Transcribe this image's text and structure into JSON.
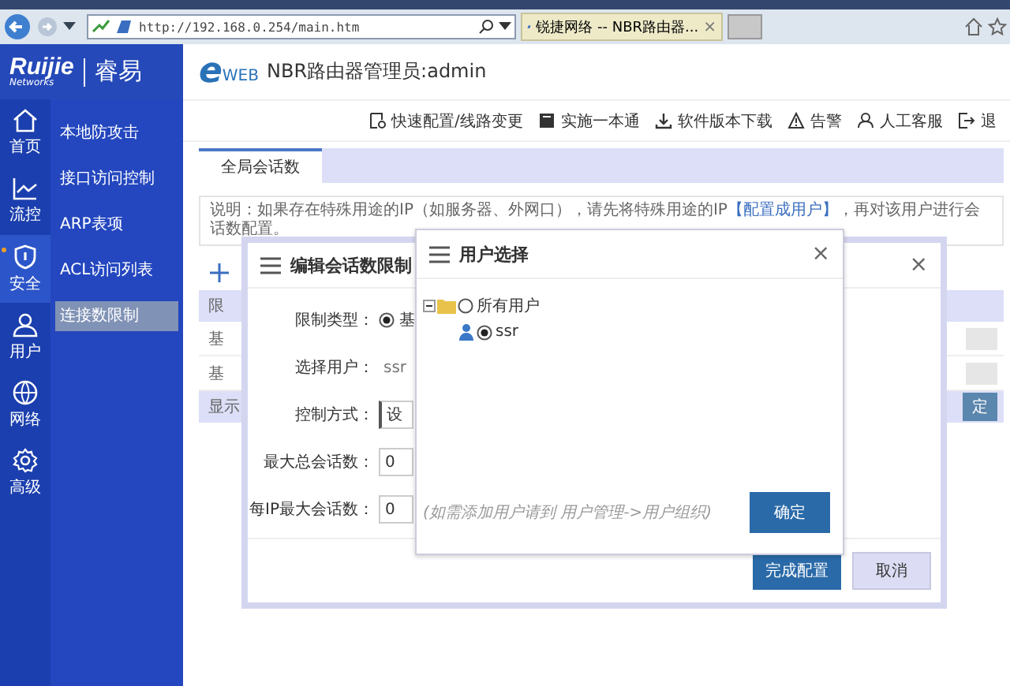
{
  "browser": {
    "address": "http://192.168.0.254/main.htm",
    "tab": {
      "title": "锐捷网络 -- NBR路由器...",
      "close": "×"
    }
  },
  "header": {
    "logo": "Ruijie",
    "logo_sub": "Networks",
    "brand": "睿易",
    "eweb_mark": "e",
    "eweb": "WEB",
    "title": "NBR路由器管理员:admin"
  },
  "toolbar": [
    {
      "kind": "config",
      "label": "快速配置/线路变更"
    },
    {
      "kind": "book",
      "label": "实施一本通"
    },
    {
      "kind": "download",
      "label": "软件版本下载"
    },
    {
      "kind": "warning",
      "label": "告警"
    },
    {
      "kind": "user",
      "label": "人工客服"
    },
    {
      "kind": "exit",
      "label": "退"
    }
  ],
  "nav": [
    {
      "kind": "home",
      "label": "首页",
      "selected": false
    },
    {
      "kind": "chart",
      "label": "流控",
      "selected": false
    },
    {
      "kind": "shield",
      "label": "安全",
      "selected": true
    },
    {
      "kind": "user",
      "label": "用户",
      "selected": false
    },
    {
      "kind": "globe",
      "label": "网络",
      "selected": false
    },
    {
      "kind": "gear",
      "label": "高级",
      "selected": false
    }
  ],
  "submenu": [
    {
      "label": "本地防攻击",
      "selected": false
    },
    {
      "label": "接口访问控制",
      "selected": false
    },
    {
      "label": "ARP表项",
      "selected": false
    },
    {
      "label": "ACL访问列表",
      "selected": false
    },
    {
      "label": "连接数限制",
      "selected": true
    }
  ],
  "tabs": [
    {
      "label": "全局会话数",
      "selected": true
    }
  ],
  "notice": {
    "before": "说明：如果存在特殊用途的IP（如服务器、外网口），请先将特殊用途的IP",
    "link": "【配置成用户】",
    "after": "，再对该用户进行会话数配置。"
  },
  "table": {
    "header": "限",
    "rows": [
      "基",
      "基"
    ],
    "footer": "显示",
    "footer_button": "定"
  },
  "dialog": {
    "title": "编辑会话数限制",
    "close": "×",
    "fields": [
      {
        "kind": "radio",
        "label": "限制类型：",
        "value": "基",
        "checked": true
      },
      {
        "kind": "text",
        "label": "选择用户：",
        "value": "ssr"
      },
      {
        "kind": "select",
        "label": "控制方式：",
        "value": "设"
      },
      {
        "kind": "input",
        "label": "最大总会话数：",
        "value": "0"
      },
      {
        "kind": "input",
        "label": "每IP最大会话数：",
        "value": "0"
      }
    ],
    "buttons": [
      {
        "kind": "primary",
        "label": "完成配置"
      },
      {
        "kind": "secondary",
        "label": "取消"
      }
    ]
  },
  "user_picker": {
    "title": "用户选择",
    "close": "×",
    "tree": [
      {
        "label": "所有用户",
        "expanded": true,
        "selected": false,
        "children": [
          {
            "label": "ssr",
            "selected": true
          }
        ]
      }
    ],
    "hint": "(如需添加用户请到 用户管理->用户组织)",
    "button": "确定"
  }
}
